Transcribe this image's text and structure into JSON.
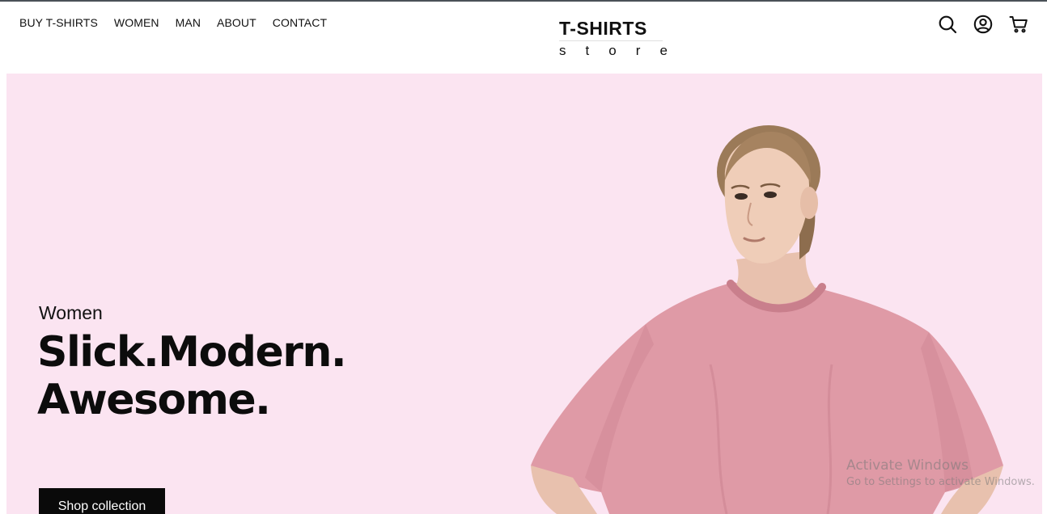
{
  "nav": {
    "items": [
      {
        "label": "BUY T-SHIRTS"
      },
      {
        "label": "WOMEN"
      },
      {
        "label": "MAN"
      },
      {
        "label": "ABOUT"
      },
      {
        "label": "CONTACT"
      }
    ]
  },
  "logo": {
    "title": "T-SHIRTS",
    "subtitle_letters": [
      "s",
      "t",
      "o",
      "r",
      "e"
    ]
  },
  "header_icons": [
    "search-icon",
    "account-icon",
    "cart-icon"
  ],
  "hero": {
    "eyebrow": "Women",
    "headline_line1": "Slick.Modern.",
    "headline_line2": "Awesome.",
    "cta_label": "Shop collection",
    "background_color": "#fbe4f1",
    "shirt_color": "#df9aa6"
  },
  "watermark": {
    "line1": "Activate Windows",
    "line2": "Go to Settings to activate Windows."
  }
}
